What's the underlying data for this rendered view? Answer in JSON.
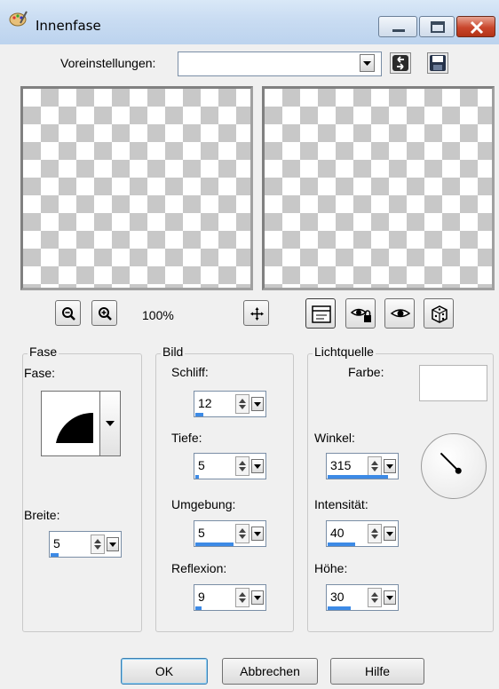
{
  "window": {
    "title": "Innenfase"
  },
  "presets": {
    "label": "Voreinstellungen:",
    "value": ""
  },
  "zoom": {
    "level": "100%"
  },
  "groups": {
    "fase": {
      "title": "Fase",
      "fase_label": "Fase:",
      "breite_label": "Breite:",
      "breite_value": "5",
      "breite_fraction": 0.12
    },
    "bild": {
      "title": "Bild",
      "schliff_label": "Schliff:",
      "schliff_value": "12",
      "schliff_fraction": 0.12,
      "tiefe_label": "Tiefe:",
      "tiefe_value": "5",
      "tiefe_fraction": 0.05,
      "umgebung_label": "Umgebung:",
      "umgebung_value": "5",
      "umgebung_fraction": 0.55,
      "reflexion_label": "Reflexion:",
      "reflexion_value": "9",
      "reflexion_fraction": 0.09
    },
    "lichtquelle": {
      "title": "Lichtquelle",
      "farbe_label": "Farbe:",
      "farbe_color": "#ffffff",
      "winkel_label": "Winkel:",
      "winkel_value": "315",
      "winkel_fraction": 0.875,
      "intensitaet_label": "Intensität:",
      "intensitaet_value": "40",
      "intensitaet_fraction": 0.4,
      "hoehe_label": "Höhe:",
      "hoehe_value": "30",
      "hoehe_fraction": 0.33
    }
  },
  "buttons": {
    "ok": "OK",
    "cancel": "Abbrechen",
    "help": "Hilfe"
  },
  "colors": {
    "accent": "#3c8ae6",
    "titlebar": "#c9dcf2",
    "close": "#c9462c"
  },
  "icons": [
    "palette-icon",
    "minimize-icon",
    "maximize-icon",
    "close-icon",
    "reset-icon",
    "save-icon",
    "zoom-out-icon",
    "zoom-in-icon",
    "pan-icon",
    "proof-icon",
    "eye-lock-icon",
    "eye-icon",
    "dice-icon",
    "bevel-shape-icon",
    "angle-dial-icon"
  ]
}
